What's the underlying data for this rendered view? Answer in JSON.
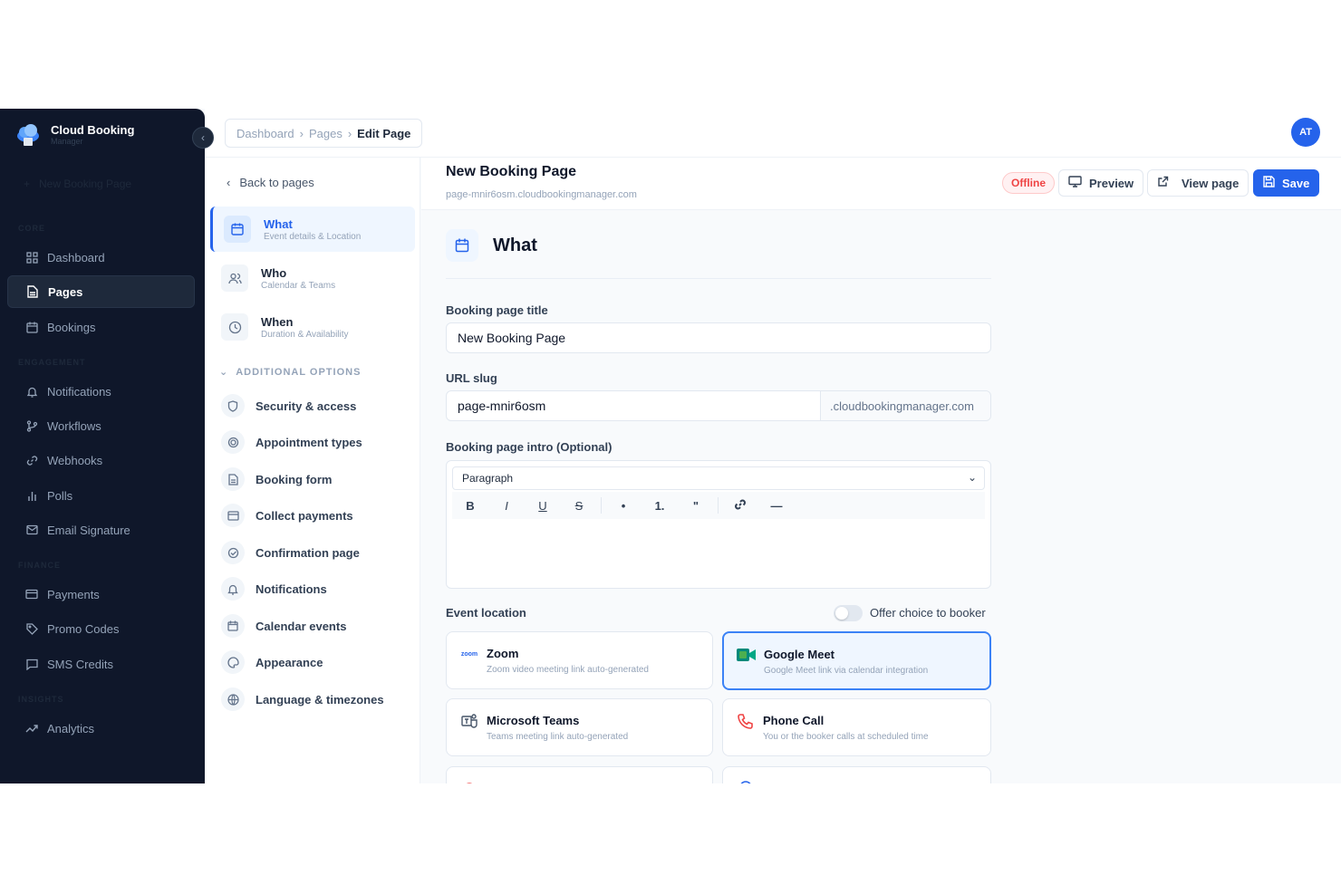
{
  "brand": {
    "name": "Cloud Booking",
    "sub": "Manager"
  },
  "sidebar": {
    "new_booking": "New Booking Page",
    "sections": {
      "core": "CORE",
      "engagement": "ENGAGEMENT",
      "finance": "FINANCE",
      "insights": "INSIGHTS"
    },
    "items": {
      "dashboard": "Dashboard",
      "pages": "Pages",
      "bookings": "Bookings",
      "notifications": "Notifications",
      "workflows": "Workflows",
      "webhooks": "Webhooks",
      "polls": "Polls",
      "email_signature": "Email Signature",
      "payments": "Payments",
      "promo_codes": "Promo Codes",
      "sms_credits": "SMS Credits",
      "analytics": "Analytics"
    },
    "active": "pages"
  },
  "breadcrumb": {
    "dashboard": "Dashboard",
    "pages": "Pages",
    "current": "Edit Page"
  },
  "user": {
    "initials": "AT"
  },
  "steps": {
    "back": "Back to pages",
    "what": {
      "title": "What",
      "sub": "Event details & Location"
    },
    "who": {
      "title": "Who",
      "sub": "Calendar & Teams"
    },
    "when": {
      "title": "When",
      "sub": "Duration & Availability"
    },
    "additional_header": "ADDITIONAL OPTIONS",
    "options": {
      "security": "Security & access",
      "appointment_types": "Appointment types",
      "booking_form": "Booking form",
      "collect_payments": "Collect payments",
      "confirmation_page": "Confirmation page",
      "notifications": "Notifications",
      "calendar_events": "Calendar events",
      "appearance": "Appearance",
      "language": "Language & timezones"
    }
  },
  "page": {
    "title": "New Booking Page",
    "url": "page-mnir6osm.cloudbookingmanager.com",
    "status": "Offline",
    "preview": "Preview",
    "view_page": "View page",
    "save": "Save"
  },
  "form": {
    "section_title": "What",
    "title_label": "Booking page title",
    "title_value": "New Booking Page",
    "slug_label": "URL slug",
    "slug_value": "page-mnir6osm",
    "slug_suffix": ".cloudbookingmanager.com",
    "intro_label": "Booking page intro (Optional)",
    "intro_format": "Paragraph",
    "toolbar": {
      "bold": "B",
      "italic": "I",
      "underline": "U",
      "strike": "S",
      "bullet": "•",
      "ordered": "1.",
      "quote": "\"",
      "link": "🔗",
      "rule": "—"
    },
    "location_label": "Event location",
    "offer_choice": "Offer choice to booker",
    "offer_choice_on": false
  },
  "locations": {
    "zoom": {
      "icon_text": "zoom",
      "title": "Zoom",
      "sub": "Zoom video meeting link auto-generated"
    },
    "google_meet": {
      "title": "Google Meet",
      "sub": "Google Meet link via calendar integration",
      "selected": true
    },
    "teams": {
      "title": "Microsoft Teams",
      "sub": "Teams meeting link auto-generated"
    },
    "phone": {
      "title": "Phone Call",
      "sub": "You or the booker calls at scheduled time"
    }
  },
  "colors": {
    "sidebar": "#0f172a",
    "accent": "#2563eb",
    "danger": "#ef4444",
    "meet": "#00897b"
  }
}
